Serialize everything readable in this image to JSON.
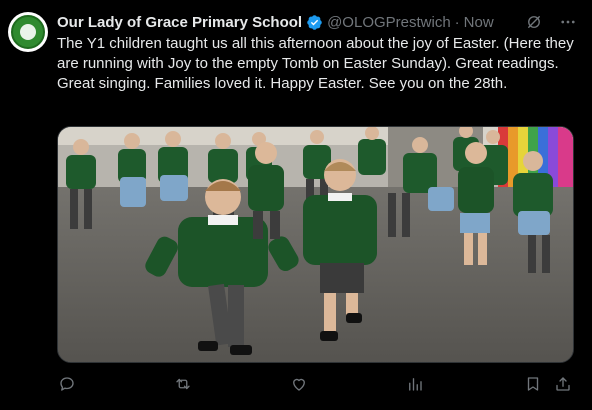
{
  "post": {
    "author": {
      "display_name": "Our Lady of Grace Primary School",
      "handle": "@OLOGPrestwich",
      "verified": true,
      "avatar": "school-crest"
    },
    "separator": "·",
    "timestamp": "Now",
    "text": "The Y1 children taught us all this afternoon about the joy of Easter. (Here they are running with Joy to the empty Tomb on Easter Sunday). Great readings. Great singing. Families loved it. Happy Easter. See you on the 28th.",
    "media": {
      "type": "image",
      "alt": "Y1 children in green school jumpers running across a playground"
    }
  },
  "icons": {
    "top": [
      "grok-icon",
      "more-icon"
    ],
    "actions": [
      "reply-icon",
      "repost-icon",
      "like-icon",
      "views-icon",
      "bookmark-icon",
      "share-icon"
    ]
  },
  "colors": {
    "background": "#000000",
    "text": "#e7e9ea",
    "secondary": "#71767b",
    "verified": "#1d9bf0",
    "uniform_green": "#1e5a2c"
  }
}
